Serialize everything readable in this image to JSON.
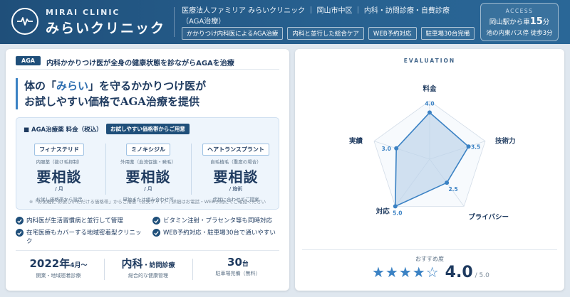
{
  "header": {
    "logo_en": "MIRAI CLINIC",
    "logo_jp": "みらいクリニック",
    "desc": "医療法人ファミリア みらいクリニック ｜ 岡山市中区 ｜ 内科・訪問診療・自費診療（AGA治療）",
    "tags": [
      "かかりつけ内科医によるAGA治療",
      "内科と並行した総合ケア",
      "WEB予約対応",
      "駐車場30台完備"
    ],
    "access": {
      "label": "ACCESS",
      "line1_pre": "岡山駅から車",
      "line1_num": "15",
      "line1_post": "分",
      "line2": "池の内東バス停 徒歩3分"
    }
  },
  "left": {
    "badge": "AGA",
    "headline": "内科かかりつけ医が全身の健康状態を診ながらAGAを治療",
    "hero_line1_pre": "体の「",
    "hero_line1_hl": "みらい",
    "hero_line1_post": "」を守るかかりつけ医が",
    "hero_line2": "お試しやすい価格でAGA治療を提供",
    "price": {
      "title": "■ AGA治療薬 料金（税込）",
      "pill": "お試しやすい価格帯からご用意",
      "items": [
        {
          "name": "フィナステリド",
          "sub": "内服薬（抜け毛抑制）",
          "price": "要相談",
          "unit": "/ 月",
          "note": "お試し価格帯から設定"
        },
        {
          "name": "ミノキシジル",
          "sub": "外用薬（血流促進・発毛）",
          "price": "要相談",
          "unit": "/ 月",
          "note": "単独または組み合わせ可"
        },
        {
          "name": "ヘアトランスプラント",
          "sub": "自毛植毛（重度の場合）",
          "price": "要相談",
          "unit": "/ 施術",
          "note": "症状に合わせてご提案"
        }
      ],
      "footnote": "※「お気軽に お試しいただける価格帯」からご用意（公式サイト）/ 詳細はお電話・WEB予約にてご確認ください"
    },
    "checks": [
      "内科医が生活習慣病と並行して管理",
      "ビタミン注射・プラセンタ等も同時対応",
      "在宅医療もカバーする地域密着型クリニック",
      "WEB予約対応・駐車場30台で通いやすい"
    ],
    "stats": [
      {
        "big": "2022年",
        "small": "4月〜",
        "sub": "開業・地域密着診療"
      },
      {
        "big": "内科",
        "small": "・訪問診療",
        "sub": "総合的な健康管理"
      },
      {
        "big": "30",
        "small": "台",
        "sub": "駐車場完備（無料）"
      }
    ]
  },
  "right": {
    "eval_title": "EVALUATION",
    "rec_label": "おすすめ度",
    "stars": "★★★★☆",
    "score": "4.0",
    "score_max": "/ 5.0"
  },
  "chart_data": {
    "type": "radar",
    "title": "EVALUATION",
    "max": 5,
    "rings": 5,
    "axes": [
      {
        "label": "料金",
        "value": 4.0
      },
      {
        "label": "技術力",
        "value": 3.5
      },
      {
        "label": "プライバシー",
        "value": 2.5
      },
      {
        "label": "対応",
        "value": 5.0
      },
      {
        "label": "実績",
        "value": 3.0
      }
    ],
    "value_labels": [
      "4.0",
      "3.5",
      "2.5",
      "5.0",
      "3.0"
    ],
    "colors": {
      "line": "#3b82c4",
      "fill": "#bcd3ea",
      "grid": "#d3dde8"
    }
  }
}
